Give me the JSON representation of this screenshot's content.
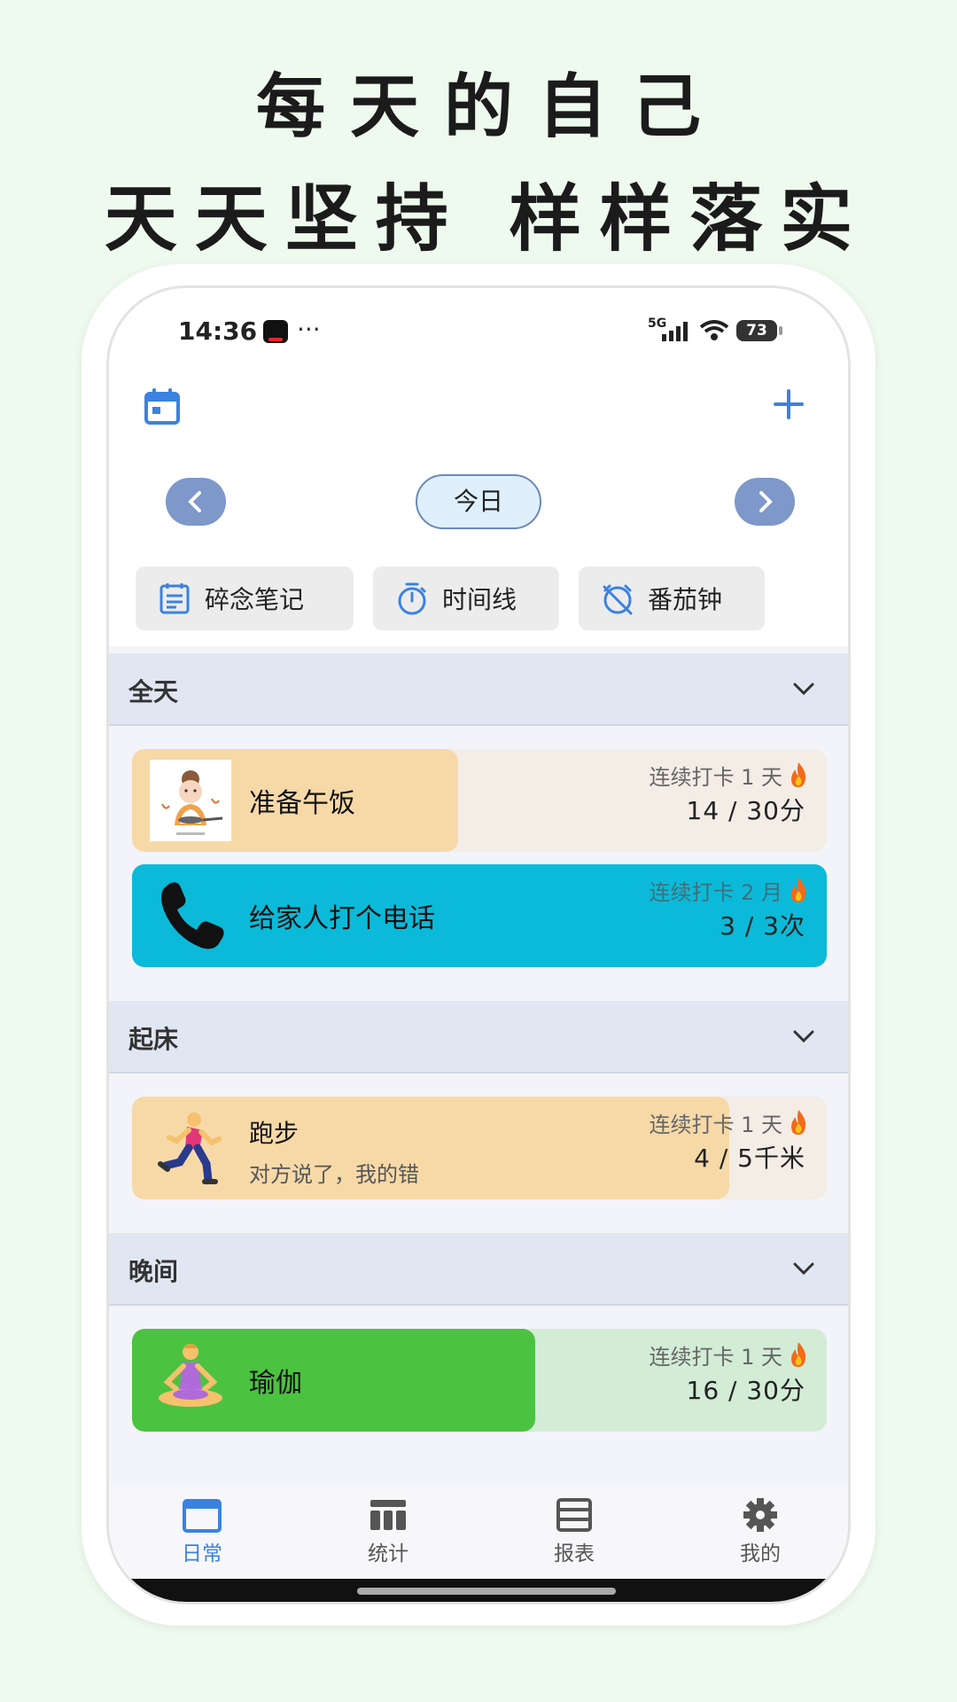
{
  "headline": {
    "line1": "每天的自己",
    "line2": "天天坚持 样样落实"
  },
  "status_bar": {
    "time": "14:36",
    "extra": "···",
    "network": "5G",
    "battery": "73"
  },
  "header": {
    "calendar_icon": "calendar-icon",
    "add_icon": "plus-icon",
    "today_label": "今日"
  },
  "tools": [
    {
      "label": "碎念笔记",
      "icon": "notes-icon"
    },
    {
      "label": "时间线",
      "icon": "stopwatch-icon"
    },
    {
      "label": "番茄钟",
      "icon": "timer-off-icon"
    }
  ],
  "sections": [
    {
      "title": "全天",
      "tasks": [
        {
          "name": "准备午饭",
          "streak": "连续打卡 1 天",
          "count": "14 / 30分",
          "progress": 0.47,
          "fill_color": "#f7d9a8",
          "bg_color": "#f3ede6"
        },
        {
          "name": "给家人打个电话",
          "streak": "连续打卡 2 月",
          "count": "3 / 3次",
          "progress": 1.0,
          "fill_color": "#0bbad8",
          "bg_color": "#0bbad8"
        }
      ]
    },
    {
      "title": "起床",
      "tasks": [
        {
          "name": "跑步",
          "note": "对方说了，我的错",
          "streak": "连续打卡 1 天",
          "count": "4 / 5千米",
          "progress": 0.8,
          "fill_color": "#f7d9a8",
          "bg_color": "#f3ede6"
        }
      ]
    },
    {
      "title": "晚间",
      "tasks": [
        {
          "name": "瑜伽",
          "streak": "连续打卡 1 天",
          "count": "16 / 30分",
          "progress": 0.53,
          "fill_color": "#4cc241",
          "bg_color": "#d2ecd6"
        }
      ]
    }
  ],
  "tabs": [
    {
      "label": "日常",
      "icon": "calendar-tab-icon",
      "active": true
    },
    {
      "label": "统计",
      "icon": "table-icon",
      "active": false
    },
    {
      "label": "报表",
      "icon": "report-icon",
      "active": false
    },
    {
      "label": "我的",
      "icon": "gear-icon",
      "active": false
    }
  ],
  "colors": {
    "accent": "#3b82e0",
    "nav_button": "#7d98c9",
    "section_header": "#e1e7f2",
    "flame": "#f26a1b"
  }
}
